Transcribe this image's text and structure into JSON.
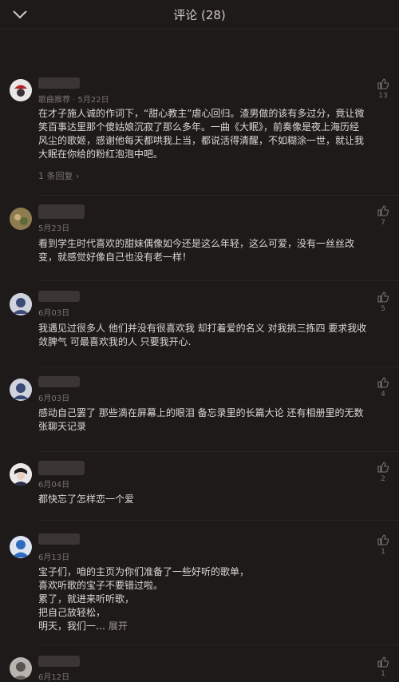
{
  "header": {
    "title": "评论 (28)"
  },
  "comments": [
    {
      "meta": "歌曲推荐 · 5月22日",
      "likes": "13",
      "text": "在才子施人诚的作词下，“甜心教主”虐心回归。渣男做的该有多过分，竟让微笑百事达里那个傻姑娘沉寂了那么多年。一曲《大眠》，前奏像是夜上海历经风尘的歌姬，感谢他每天都哄我上当，都说活得清醒，不如糊涂一世，就让我大眠在你给的粉红泡泡中吧。",
      "replies": "1 条回复 ›"
    },
    {
      "meta": "5月23日",
      "likes": "7",
      "text": "看到学生时代喜欢的甜妹偶像如今还是这么年轻，这么可爱，没有一丝丝改变，就感觉好像自己也没有老一样！"
    },
    {
      "meta": "6月03日",
      "likes": "5",
      "text": "我遇见过很多人 他们并没有很喜欢我 却打着爱的名义 对我挑三拣四 要求我收敛脾气 可最喜欢我的人 只要我开心."
    },
    {
      "meta": "6月03日",
      "likes": "4",
      "text": "感动自己罢了 那些滴在屏幕上的眼泪 备忘录里的长篇大论 还有相册里的无数张聊天记录"
    },
    {
      "meta": "6月04日",
      "likes": "2",
      "text": "都快忘了怎样恋一个爱"
    },
    {
      "meta": "6月13日",
      "likes": "1",
      "lines": [
        "宝子们，咱的主页为你们准备了一些好听的歌单，",
        "喜欢听歌的宝子不要错过啦。",
        "累了，就进来听听歌，",
        "把自己放轻松，",
        "明天，我们一…"
      ],
      "expand": "展开"
    },
    {
      "meta": "6月12日",
      "likes": "1"
    }
  ]
}
